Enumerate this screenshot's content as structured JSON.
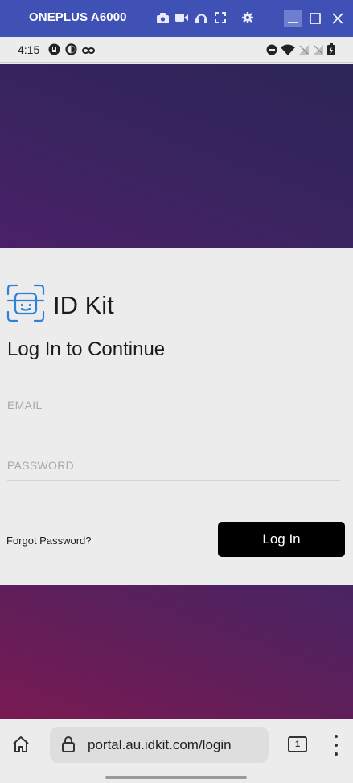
{
  "window": {
    "title": "ONEPLUS A6000",
    "tools": [
      "camera-icon",
      "video-icon",
      "headphones-icon",
      "fullscreen-icon",
      "settings-icon"
    ],
    "controls": [
      "minimize-icon",
      "maximize-icon",
      "close-icon"
    ],
    "accent": "#3f51b5"
  },
  "statusbar": {
    "time": "4:15",
    "left_icons": [
      "app-notification-icon",
      "sync-icon",
      "link-icon"
    ],
    "right_icons": [
      "dnd-icon",
      "wifi-icon",
      "signal-off-icon",
      "signal-off-icon",
      "battery-icon"
    ]
  },
  "login": {
    "brand": "ID Kit",
    "heading": "Log In to Continue",
    "email_label": "EMAIL",
    "password_label": "PASSWORD",
    "forgot": "Forgot Password?",
    "submit": "Log In"
  },
  "browser": {
    "url": "portal.au.idkit.com/login",
    "tab_count": "1"
  },
  "colors": {
    "top_band": "#3a2460",
    "bottom_band": "#6a1d58",
    "button": "#000000"
  }
}
